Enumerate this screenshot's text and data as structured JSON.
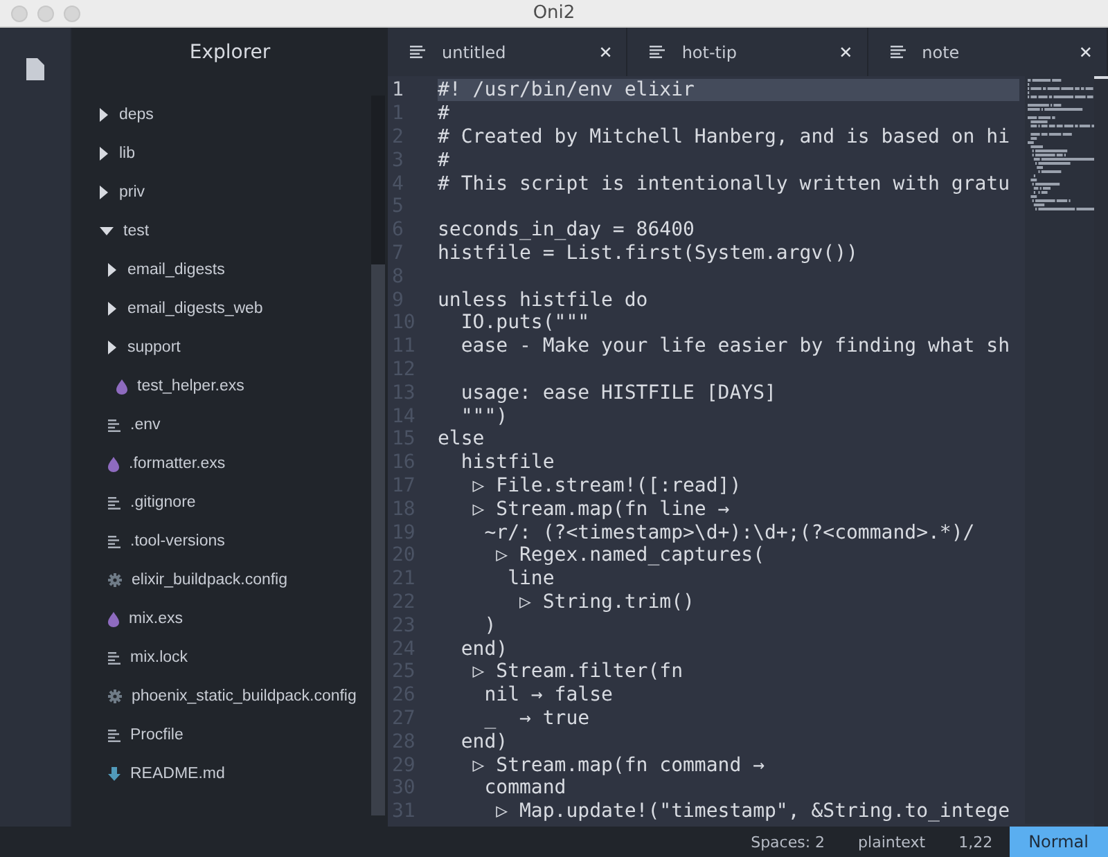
{
  "window": {
    "title": "Oni2"
  },
  "explorer": {
    "title": "Explorer",
    "items": [
      {
        "kind": "folder",
        "name": "deps",
        "expanded": false
      },
      {
        "kind": "folder",
        "name": "lib",
        "expanded": false
      },
      {
        "kind": "folder",
        "name": "priv",
        "expanded": false
      },
      {
        "kind": "folder",
        "name": "test",
        "expanded": true,
        "children": [
          {
            "kind": "folder",
            "name": "email_digests",
            "expanded": false
          },
          {
            "kind": "folder",
            "name": "email_digests_web",
            "expanded": false
          },
          {
            "kind": "folder",
            "name": "support",
            "expanded": false
          },
          {
            "kind": "elixir",
            "name": "test_helper.exs"
          }
        ]
      },
      {
        "kind": "text",
        "name": ".env"
      },
      {
        "kind": "elixir",
        "name": ".formatter.exs"
      },
      {
        "kind": "text",
        "name": ".gitignore"
      },
      {
        "kind": "text",
        "name": ".tool-versions"
      },
      {
        "kind": "config",
        "name": "elixir_buildpack.config"
      },
      {
        "kind": "elixir",
        "name": "mix.exs"
      },
      {
        "kind": "text",
        "name": "mix.lock"
      },
      {
        "kind": "config",
        "name": "phoenix_static_buildpack.config"
      },
      {
        "kind": "text",
        "name": "Procfile"
      },
      {
        "kind": "markdown",
        "name": "README.md"
      }
    ]
  },
  "tabs": [
    {
      "label": "untitled",
      "close": "✕"
    },
    {
      "label": "hot-tip",
      "close": "✕"
    },
    {
      "label": "note",
      "close": "✕"
    }
  ],
  "code": [
    {
      "number": "1",
      "text": "#! /usr/bin/env elixir",
      "current": true
    },
    {
      "number": "1",
      "text": "#",
      "current": false
    },
    {
      "number": "2",
      "text": "# Created by Mitchell Hanberg, and is based on hi",
      "current": false
    },
    {
      "number": "3",
      "text": "#",
      "current": false
    },
    {
      "number": "4",
      "text": "# This script is intentionally written with gratu",
      "current": false
    },
    {
      "number": "5",
      "current": false
    },
    {
      "number": "6",
      "text": "seconds_in_day = 86400",
      "current": false
    },
    {
      "number": "7",
      "text": "histfile = List.first(System.argv())",
      "current": false
    },
    {
      "number": "8",
      "current": false
    },
    {
      "number": "9",
      "text": "unless histfile do",
      "current": false
    },
    {
      "number": "10",
      "text": "  IO.puts(\"\"\"",
      "current": false
    },
    {
      "number": "11",
      "text": "  ease - Make your life easier by finding what sh",
      "current": false
    },
    {
      "number": "12",
      "current": false
    },
    {
      "number": "13",
      "text": "  usage: ease HISTFILE [DAYS]",
      "current": false
    },
    {
      "number": "14",
      "text": "  \"\"\")",
      "current": false
    },
    {
      "number": "15",
      "text": "else",
      "current": false
    },
    {
      "number": "16",
      "text": "  histfile",
      "current": false
    },
    {
      "number": "17",
      "text": "   ▷ File.stream!([:read])",
      "current": false
    },
    {
      "number": "18",
      "text": "   ▷ Stream.map(fn line →",
      "current": false
    },
    {
      "number": "19",
      "text": "    ~r/: (?<timestamp>\\d+):\\d+;(?<command>.*)/",
      "current": false
    },
    {
      "number": "20",
      "text": "     ▷ Regex.named_captures(",
      "current": false
    },
    {
      "number": "21",
      "text": "      line",
      "current": false
    },
    {
      "number": "22",
      "text": "       ▷ String.trim()",
      "current": false
    },
    {
      "number": "23",
      "text": "    )",
      "current": false
    },
    {
      "number": "24",
      "text": "  end)",
      "current": false
    },
    {
      "number": "25",
      "text": "   ▷ Stream.filter(fn",
      "current": false
    },
    {
      "number": "26",
      "text": "    nil → false",
      "current": false
    },
    {
      "number": "27",
      "text": "    _  → true",
      "current": false
    },
    {
      "number": "28",
      "text": "  end)",
      "current": false
    },
    {
      "number": "29",
      "text": "   ▷ Stream.map(fn command →",
      "current": false
    },
    {
      "number": "30",
      "text": "    command",
      "current": false
    },
    {
      "number": "31",
      "text": "     ▷ Map.update!(\"timestamp\", &String.to_intege",
      "current": false
    }
  ],
  "status_bar": {
    "items": [
      "Spaces: 2",
      "plaintext",
      "1,22"
    ],
    "mode": "Normal"
  }
}
